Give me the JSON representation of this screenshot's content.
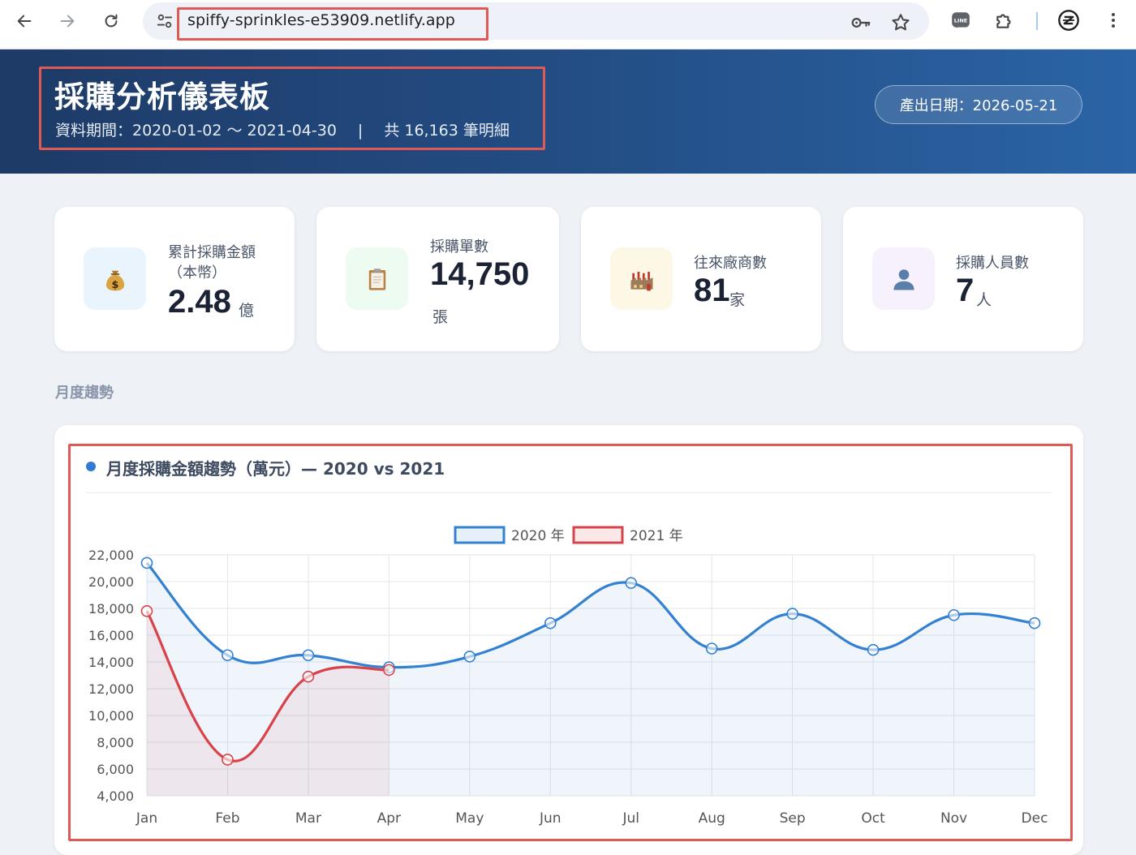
{
  "browser": {
    "url": "spiffy-sprinkles-e53909.netlify.app",
    "icons": [
      "back-arrow-icon",
      "forward-arrow-icon",
      "reload-icon",
      "site-info-icon",
      "password-key-icon",
      "bookmark-star-icon",
      "line-extension-icon",
      "extensions-puzzle-icon",
      "profile-icon",
      "more-menu-icon"
    ]
  },
  "header": {
    "title": "採購分析儀表板",
    "period": "資料期間：2020-01-02 ～ 2021-04-30",
    "separator": "|",
    "record_count": "共 16,163 筆明細",
    "generated_date": "產出日期：2026-05-21"
  },
  "kpis": [
    {
      "label_line1": "累計採購金額",
      "label_line2": "（本幣）",
      "value": "2.48",
      "unit": "億",
      "icon": "money-bag-icon",
      "icon_bg": "#eaf4fd"
    },
    {
      "label": "採購單數",
      "value": "14,750",
      "unit": "張",
      "icon": "clipboard-icon",
      "icon_bg": "#eefbf1"
    },
    {
      "label": "往來廠商數",
      "value": "81",
      "unit": "家",
      "icon": "factory-icon",
      "icon_bg": "#fdf8e6"
    },
    {
      "label": "採購人員數",
      "value": "7",
      "unit": "人",
      "icon": "person-silhouette-icon",
      "icon_bg": "#f6f1fd"
    }
  ],
  "section_title": "月度趨勢",
  "chart_title": "月度採購金額趨勢（萬元）— 2020 vs 2021",
  "chart_data": {
    "type": "line",
    "title": "月度採購金額趨勢（萬元）— 2020 vs 2021",
    "categories": [
      "Jan",
      "Feb",
      "Mar",
      "Apr",
      "May",
      "Jun",
      "Jul",
      "Aug",
      "Sep",
      "Oct",
      "Nov",
      "Dec"
    ],
    "series": [
      {
        "name": "2020 年",
        "color": "#3381d0",
        "fill": "rgba(51,129,208,0.08)",
        "values": [
          21400,
          14500,
          14500,
          13600,
          14400,
          16900,
          19900,
          15000,
          17600,
          14900,
          17500,
          16900
        ]
      },
      {
        "name": "2021 年",
        "color": "#d8434a",
        "fill": "rgba(216,67,74,0.08)",
        "values": [
          17800,
          6700,
          12900,
          13400
        ]
      }
    ],
    "ylim": [
      4000,
      22000
    ],
    "yticks": [
      "4,000",
      "6,000",
      "8,000",
      "10,000",
      "12,000",
      "14,000",
      "16,000",
      "18,000",
      "20,000",
      "22,000"
    ],
    "ytick_values": [
      4000,
      6000,
      8000,
      10000,
      12000,
      14000,
      16000,
      18000,
      20000,
      22000
    ],
    "grid": true,
    "legend_position": "top-center"
  }
}
